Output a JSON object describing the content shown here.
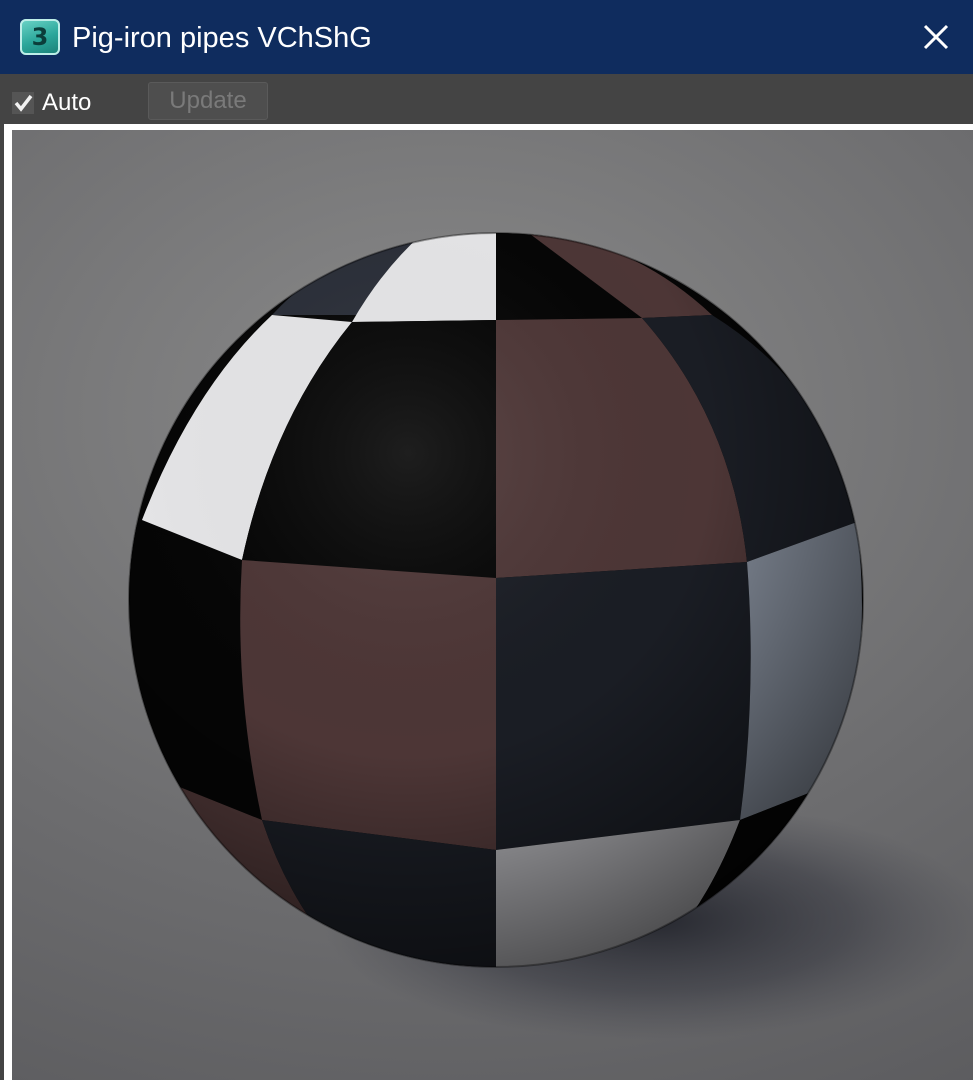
{
  "window": {
    "title": "Pig-iron pipes VChShG",
    "app_icon": "3",
    "app_icon_name": "3ds-max-app-icon",
    "close_icon": "close-icon"
  },
  "toolbar": {
    "auto_label": "Auto",
    "auto_checked": true,
    "update_label": "Update",
    "update_enabled": false
  },
  "preview": {
    "content": "material-preview-sphere",
    "colors": {
      "background": "#6d6d6f",
      "checker_white": "#e6e6e8",
      "checker_black": "#050505",
      "checker_brown": "#4d3636",
      "checker_dark_blue": "#1a1d24",
      "checker_gray_blue": "#7f8794"
    }
  }
}
